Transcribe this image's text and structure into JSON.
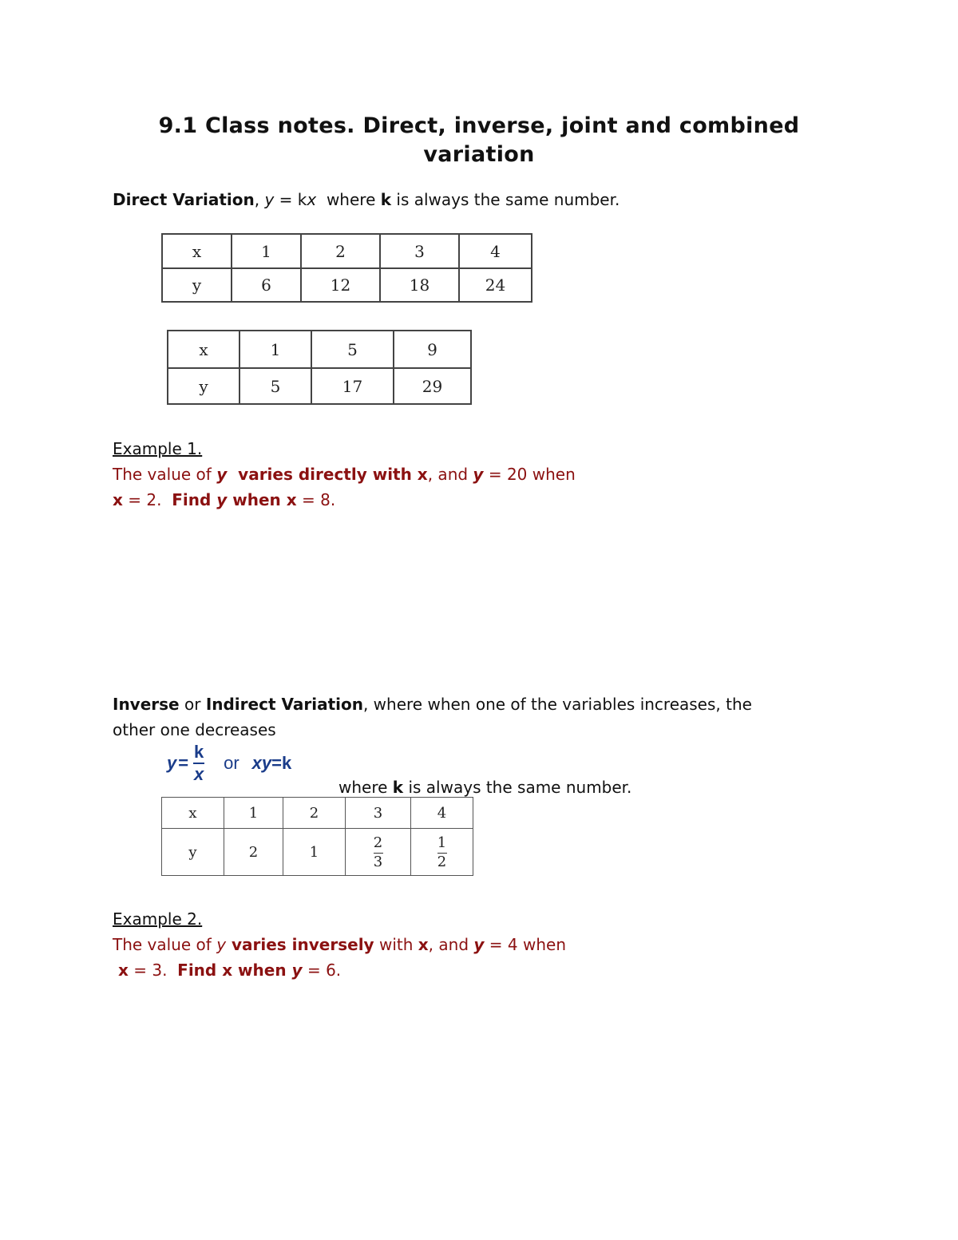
{
  "title": {
    "line1": "9.1 Class notes. Direct, inverse, joint and combined",
    "line2": "variation"
  },
  "direct": {
    "heading": "Direct Variation",
    "sep": ", ",
    "eq_y": "y",
    "eq_rest": " = k",
    "eq_x": "x",
    "where": "  where ",
    "k": "k",
    "tail": " is always the same number.",
    "table1": {
      "x_label": "x",
      "y_label": "y",
      "x": [
        "1",
        "2",
        "3",
        "4"
      ],
      "y": [
        "6",
        "12",
        "18",
        "24"
      ]
    },
    "table2": {
      "x_label": "x",
      "y_label": "y",
      "x": [
        "1",
        "5",
        "9"
      ],
      "y": [
        "5",
        "17",
        "29"
      ]
    }
  },
  "example1": {
    "label": "Example 1.",
    "p1": "The value of ",
    "y1": "y",
    "p2": "  varies directly with x",
    "p3": ", and ",
    "y2": "y",
    "p4": " = 20 when",
    "l2a": "x",
    "l2b": " = 2.  ",
    "l2c": "Find ",
    "l2d": "y",
    "l2e": " when x",
    "l2f": " = 8."
  },
  "inverse": {
    "h1": "Inverse",
    "or": " or ",
    "h2": "Indirect Variation",
    "rest1": ", where when one of the variables increases, the",
    "rest2": "other one decreases",
    "formula": {
      "y": "y",
      "eq": "=",
      "num": "k",
      "den": "x",
      "or": "or",
      "xy": "xy",
      "eq2": "=k"
    },
    "where": "where ",
    "k": "k",
    "tail": " is always the same number.",
    "table": {
      "x_label": "x",
      "y_label": "y",
      "x": [
        "1",
        "2",
        "3",
        "4"
      ],
      "y": [
        {
          "whole": "2"
        },
        {
          "whole": "1"
        },
        {
          "num": "2",
          "den": "3"
        },
        {
          "num": "1",
          "den": "2"
        }
      ]
    }
  },
  "example2": {
    "label": "Example 2.",
    "p1": "The value of ",
    "y1": "y",
    "p2": " varies inversely",
    "p3": " with ",
    "x1": "x",
    "p4": ", and ",
    "y2": "y",
    "p5": " = 4 when",
    "l2a": " x",
    "l2b": " = 3.  ",
    "l2c": "Find x when ",
    "l2d": "y",
    "l2e": " = 6."
  },
  "colors": {
    "example_text": "#8b1111",
    "formula": "#1a3c8a"
  }
}
